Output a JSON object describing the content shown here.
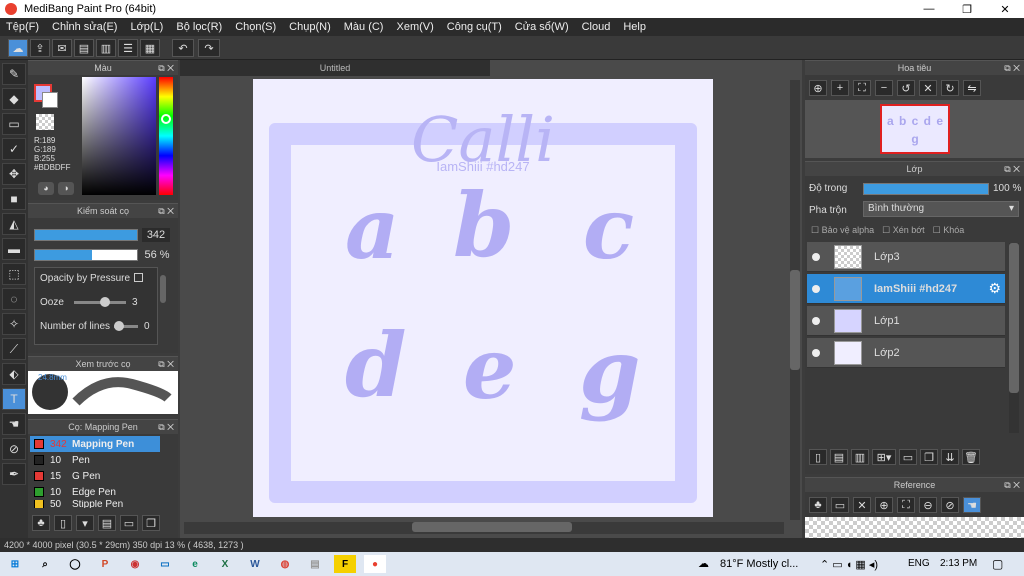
{
  "window": {
    "title": "MediBang Paint Pro (64bit)",
    "minimize": "—",
    "restore": "❐",
    "close": "✕"
  },
  "menu": [
    "Tệp(F)",
    "Chỉnh sửa(E)",
    "Lớp(L)",
    "Bộ lọc(R)",
    "Chọn(S)",
    "Chụp(N)",
    "Màu (C)",
    "Xem(V)",
    "Công cụ(T)",
    "Cửa sổ(W)",
    "Cloud",
    "Help"
  ],
  "color_panel": {
    "title": "Màu",
    "r": "R:189",
    "g": "G:189",
    "b": "B:255",
    "hex": "#BDBDFF",
    "fg_color": "#bdbdff"
  },
  "brush_control": {
    "title": "Kiểm soát cọ",
    "size": "342",
    "opacity": "56 %",
    "opacity_by_pressure": "Opacity by Pressure",
    "ooze_label": "Ooze",
    "ooze_value": "3",
    "lines_label": "Number of lines",
    "lines_value": "0"
  },
  "brush_preview": {
    "title": "Xem trước cọ",
    "size_label": "24.8mm"
  },
  "brush_list": {
    "title": "Cọ: Mapping Pen",
    "items": [
      {
        "size": "342",
        "name": "Mapping Pen",
        "color": "#e53935"
      },
      {
        "size": "10",
        "name": "Pen",
        "color": "#222222"
      },
      {
        "size": "15",
        "name": "G Pen",
        "color": "#e53935"
      },
      {
        "size": "10",
        "name": "Edge Pen",
        "color": "#2e9e2e"
      },
      {
        "size": "50",
        "name": "Stipple Pen",
        "color": "#f0c020"
      }
    ]
  },
  "document": {
    "tab": "Untitled",
    "title_art": "Calli",
    "watermark": "IamShiii #hd247",
    "letters": [
      "a",
      "b",
      "c",
      "d",
      "e",
      "g"
    ]
  },
  "navigator": {
    "title": "Hoa tiêu",
    "thumb_letters": "a b c d e g"
  },
  "layers": {
    "title": "Lớp",
    "opacity_label": "Độ trong",
    "opacity_value": "100 %",
    "blend_label": "Pha trộn",
    "blend_value": "Bình thường",
    "protect_alpha": "Bảo vệ alpha",
    "clipping": "Xén bớt",
    "lock": "Khóa",
    "items": [
      {
        "name": "Lớp3",
        "selected": false
      },
      {
        "name": "IamShiii #hd247",
        "selected": true
      },
      {
        "name": "Lớp1",
        "selected": false
      },
      {
        "name": "Lớp2",
        "selected": false
      }
    ]
  },
  "reference": {
    "title": "Reference"
  },
  "status": {
    "text": "4200 * 4000 pixel  (30.5 * 29cm)  350 dpi  13 %  ( 4638, 1273 )"
  },
  "taskbar": {
    "weather": "81°F  Mostly cl...",
    "lang": "ENG",
    "time": "2:13 PM"
  }
}
